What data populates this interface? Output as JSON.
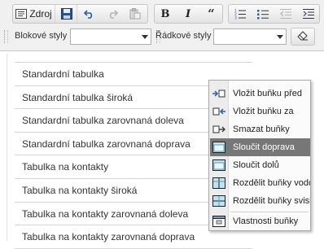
{
  "toolbar": {
    "source_label": "Zdroj",
    "source_icon": "source-icon",
    "buttons": [
      {
        "name": "save",
        "icon": "save-icon"
      },
      {
        "name": "undo",
        "icon": "undo-icon"
      },
      {
        "name": "redo",
        "icon": "redo-icon"
      },
      {
        "name": "paste",
        "icon": "paste-icon"
      },
      {
        "name": "bold",
        "icon": "bold-icon"
      },
      {
        "name": "italic",
        "icon": "italic-icon"
      },
      {
        "name": "blockquote",
        "icon": "quote-icon"
      },
      {
        "name": "numbered-list",
        "icon": "numbered-list-icon"
      },
      {
        "name": "bulleted-list",
        "icon": "bulleted-list-icon"
      },
      {
        "name": "outdent",
        "icon": "outdent-icon"
      },
      {
        "name": "indent",
        "icon": "indent-icon"
      }
    ],
    "block_styles_label": "Blokové styly",
    "block_styles_value": "",
    "inline_styles_label": "Řádkové styly",
    "inline_styles_value": "",
    "remove_format_icon": "eraser-icon"
  },
  "styles_list": {
    "items": [
      "Standardní tabulka",
      "Standardní tabulka široká",
      "Standardní tabulka zarovnaná doleva",
      "Standardní tabulka zarovnaná doprava",
      "Tabulka na kontakty",
      "Tabulka na kontakty široká",
      "Tabulka na kontakty zarovnaná doleva",
      "Tabulka na kontakty zarovnaná doprava"
    ]
  },
  "context_menu": {
    "items": [
      {
        "label": "Vložit buňku před",
        "icon": "insert-cell-before-icon"
      },
      {
        "label": "Vložit buňku za",
        "icon": "insert-cell-after-icon"
      },
      {
        "label": "Smazat buňky",
        "icon": "delete-cells-icon"
      },
      {
        "label": "Sloučit doprava",
        "icon": "merge-right-icon",
        "active": true
      },
      {
        "label": "Sloučit dolů",
        "icon": "merge-down-icon"
      },
      {
        "label": "Rozdělit buňky vodorovně",
        "icon": "split-horizontal-icon"
      },
      {
        "label": "Rozdělit buňky svisle",
        "icon": "split-vertical-icon"
      },
      {
        "label": "Vlastnosti buňky",
        "icon": "cell-properties-icon"
      }
    ]
  },
  "colors": {
    "toolbar_bg": "#f0f0f0",
    "menu_highlight": "#777777",
    "icon_blue": "#2b5fa8"
  }
}
